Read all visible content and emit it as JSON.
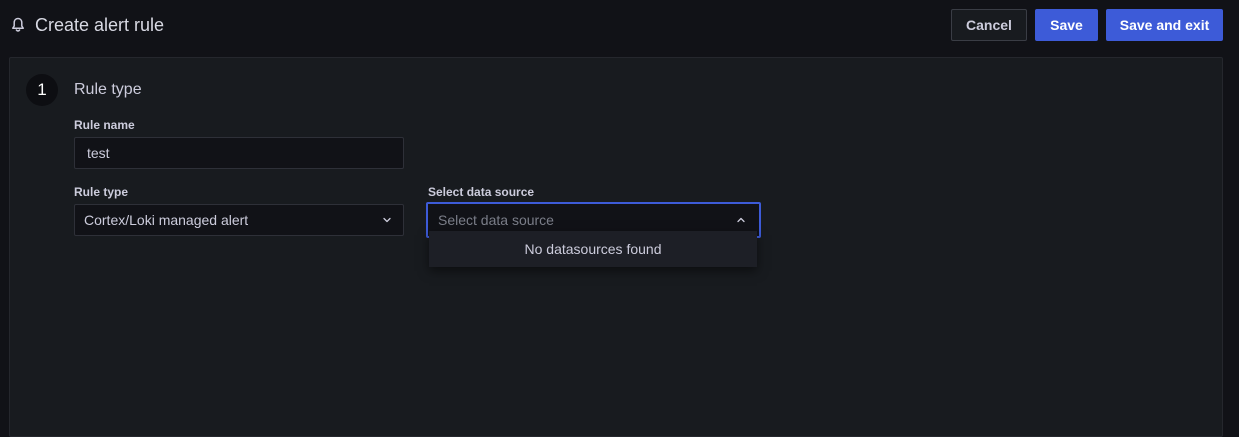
{
  "header": {
    "icon": "bell-icon",
    "title": "Create alert rule",
    "cancel_label": "Cancel",
    "save_label": "Save",
    "save_exit_label": "Save and exit"
  },
  "step": {
    "number": "1",
    "title": "Rule type"
  },
  "rule_name": {
    "label": "Rule name",
    "value": "test"
  },
  "rule_type": {
    "label": "Rule type",
    "value": "Cortex/Loki managed alert"
  },
  "data_source": {
    "label": "Select data source",
    "placeholder": "Select data source",
    "empty_message": "No datasources found"
  },
  "colors": {
    "accent": "#3d5bd8",
    "background": "#111217",
    "panel": "#181b1f"
  }
}
